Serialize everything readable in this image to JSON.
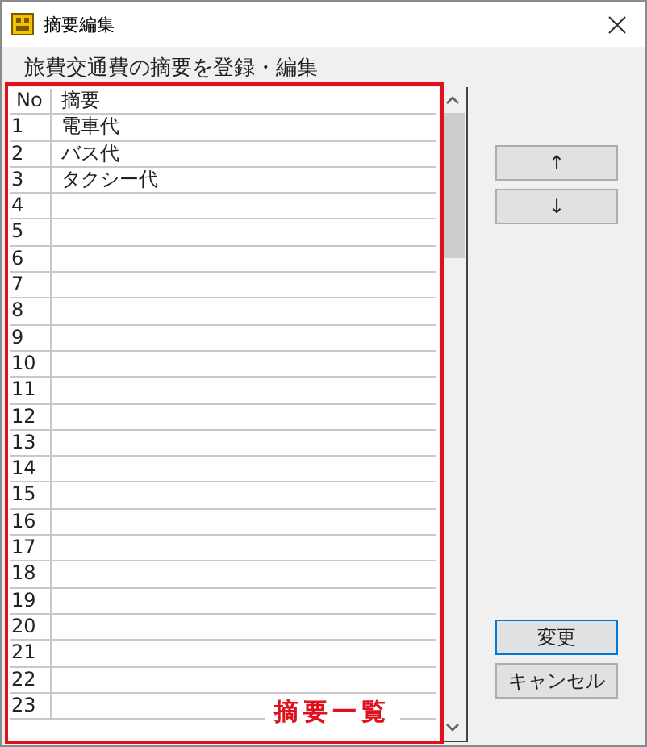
{
  "window": {
    "title": "摘要編集"
  },
  "heading": "旅費交通費の摘要を登録・編集",
  "table": {
    "columns": [
      "No",
      "摘要"
    ],
    "rows": [
      {
        "no": "1",
        "text": "電車代"
      },
      {
        "no": "2",
        "text": "バス代"
      },
      {
        "no": "3",
        "text": "タクシー代"
      },
      {
        "no": "4"
      },
      {
        "no": "5"
      },
      {
        "no": "6"
      },
      {
        "no": "7"
      },
      {
        "no": "8"
      },
      {
        "no": "9"
      },
      {
        "no": "10"
      },
      {
        "no": "11"
      },
      {
        "no": "12"
      },
      {
        "no": "13"
      },
      {
        "no": "14"
      },
      {
        "no": "15"
      },
      {
        "no": "16"
      },
      {
        "no": "17"
      },
      {
        "no": "18"
      },
      {
        "no": "19"
      },
      {
        "no": "20"
      },
      {
        "no": "21"
      },
      {
        "no": "22"
      },
      {
        "no": "23"
      }
    ]
  },
  "annotation": "摘要一覧",
  "move_buttons": [
    "↑",
    "↓"
  ],
  "buttons": [
    {
      "label": "変更",
      "kind": "default"
    },
    {
      "label": "キャンセル",
      "kind": "normal"
    }
  ]
}
